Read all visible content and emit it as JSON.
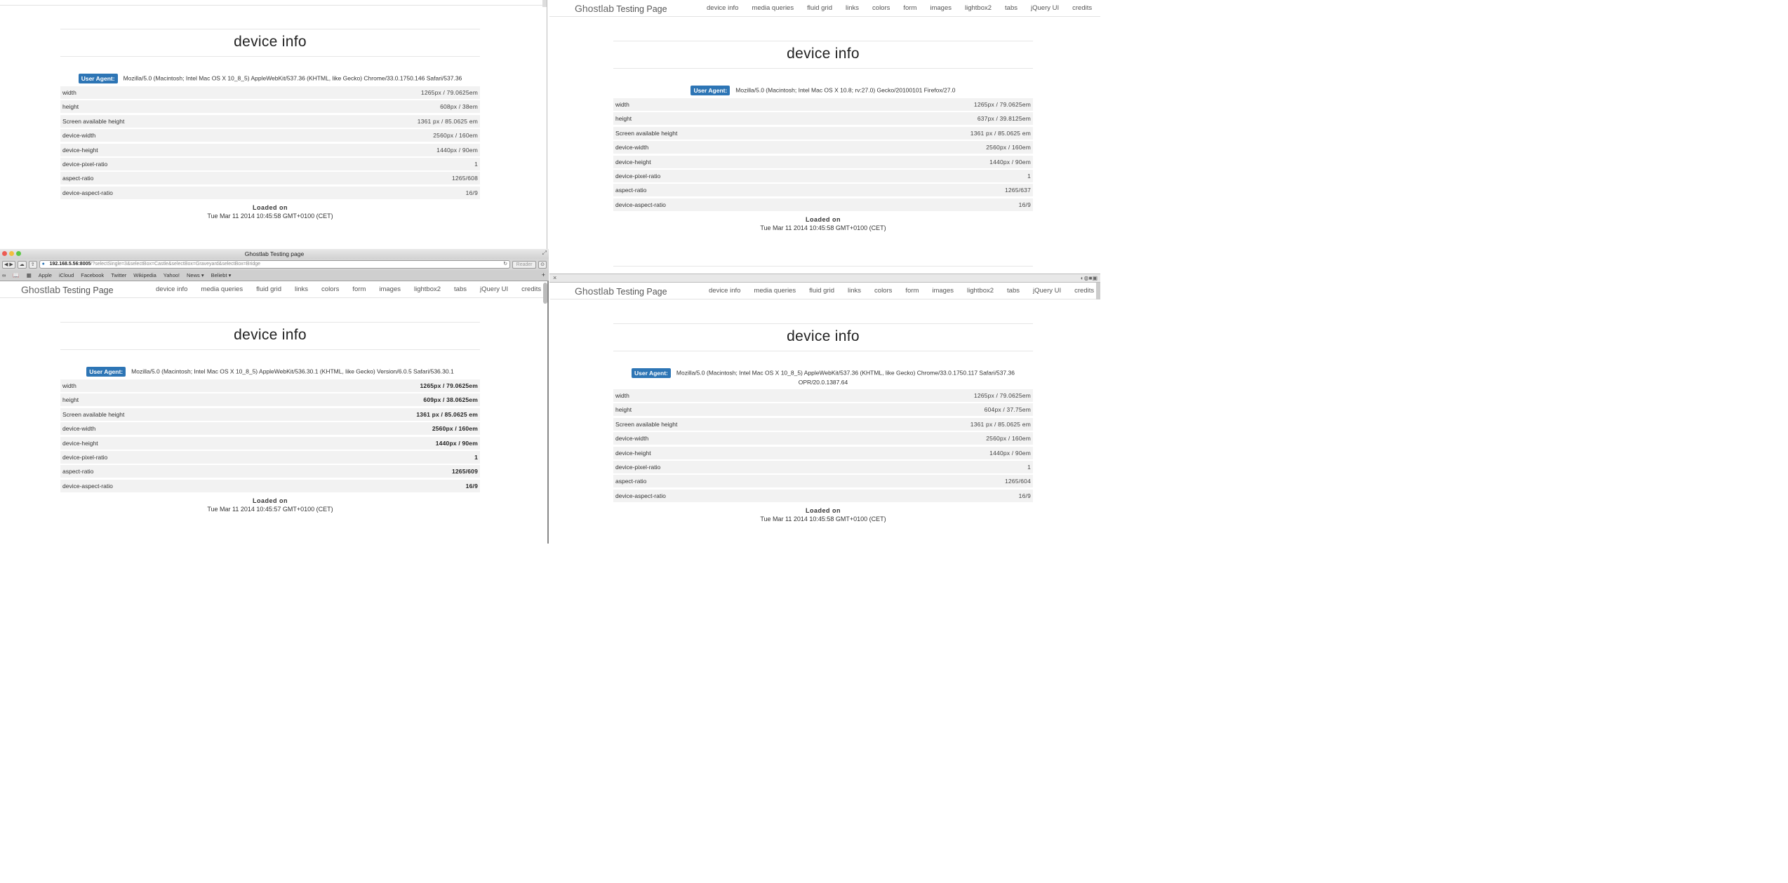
{
  "brand": {
    "name": "Ghostlab",
    "suffix": "Testing Page"
  },
  "nav": [
    "device info",
    "media queries",
    "fluid grid",
    "links",
    "colors",
    "form",
    "images",
    "lightbox2",
    "tabs",
    "jQuery UI",
    "credits"
  ],
  "labels": {
    "heading": "device info",
    "badge": "User Agent:",
    "loaded": "Loaded on"
  },
  "row_labels": [
    "width",
    "height",
    "Screen available height",
    "device-width",
    "device-height",
    "device-pixel-ratio",
    "aspect-ratio",
    "device-aspect-ratio"
  ],
  "panes": {
    "top_left": {
      "ua": "Mozilla/5.0 (Macintosh; Intel Mac OS X 10_8_5) AppleWebKit/537.36 (KHTML, like Gecko) Chrome/33.0.1750.146 Safari/537.36",
      "values": [
        "1265px / 79.0625em",
        "608px / 38em",
        "1361 px / 85.0625 em",
        "2560px / 160em",
        "1440px / 90em",
        "1",
        "1265/608",
        "16/9"
      ],
      "loaded": "Tue Mar 11 2014 10:45:58 GMT+0100 (CET)"
    },
    "top_right": {
      "ua": "Mozilla/5.0 (Macintosh; Intel Mac OS X 10.8; rv:27.0) Gecko/20100101 Firefox/27.0",
      "values": [
        "1265px / 79.0625em",
        "637px / 39.8125em",
        "1361 px / 85.0625 em",
        "2560px / 160em",
        "1440px / 90em",
        "1",
        "1265/637",
        "16/9"
      ],
      "loaded": "Tue Mar 11 2014 10:45:58 GMT+0100 (CET)"
    },
    "bottom_left": {
      "ua": "Mozilla/5.0 (Macintosh; Intel Mac OS X 10_8_5) AppleWebKit/536.30.1 (KHTML, like Gecko) Version/6.0.5 Safari/536.30.1",
      "values": [
        "1265px / 79.0625em",
        "609px / 38.0625em",
        "1361 px / 85.0625 em",
        "2560px / 160em",
        "1440px / 90em",
        "1",
        "1265/609",
        "16/9"
      ],
      "loaded": "Tue Mar 11 2014 10:45:57 GMT+0100 (CET)"
    },
    "bottom_right": {
      "ua": "Mozilla/5.0 (Macintosh; Intel Mac OS X 10_8_5) AppleWebKit/537.36 (KHTML, like Gecko) Chrome/33.0.1750.117 Safari/537.36 OPR/20.0.1387.64",
      "values": [
        "1265px / 79.0625em",
        "604px / 37.75em",
        "1361 px / 85.0625 em",
        "2560px / 160em",
        "1440px / 90em",
        "1",
        "1265/604",
        "16/9"
      ],
      "loaded": "Tue Mar 11 2014 10:45:58 GMT+0100 (CET)"
    }
  },
  "safari": {
    "window_title": "Ghostlab Testing page",
    "address_host": "192.168.5.56:8005",
    "address_path": "/?selectSingle=3&selectBox=Castle&selectBox=Graveyard&selectBox=Bridge",
    "reader": "Reader",
    "bookmarks": [
      "Apple",
      "iCloud",
      "Facebook",
      "Twitter",
      "Wikipedia",
      "Yahoo!",
      "News ▾",
      "Beliebt ▾"
    ]
  }
}
